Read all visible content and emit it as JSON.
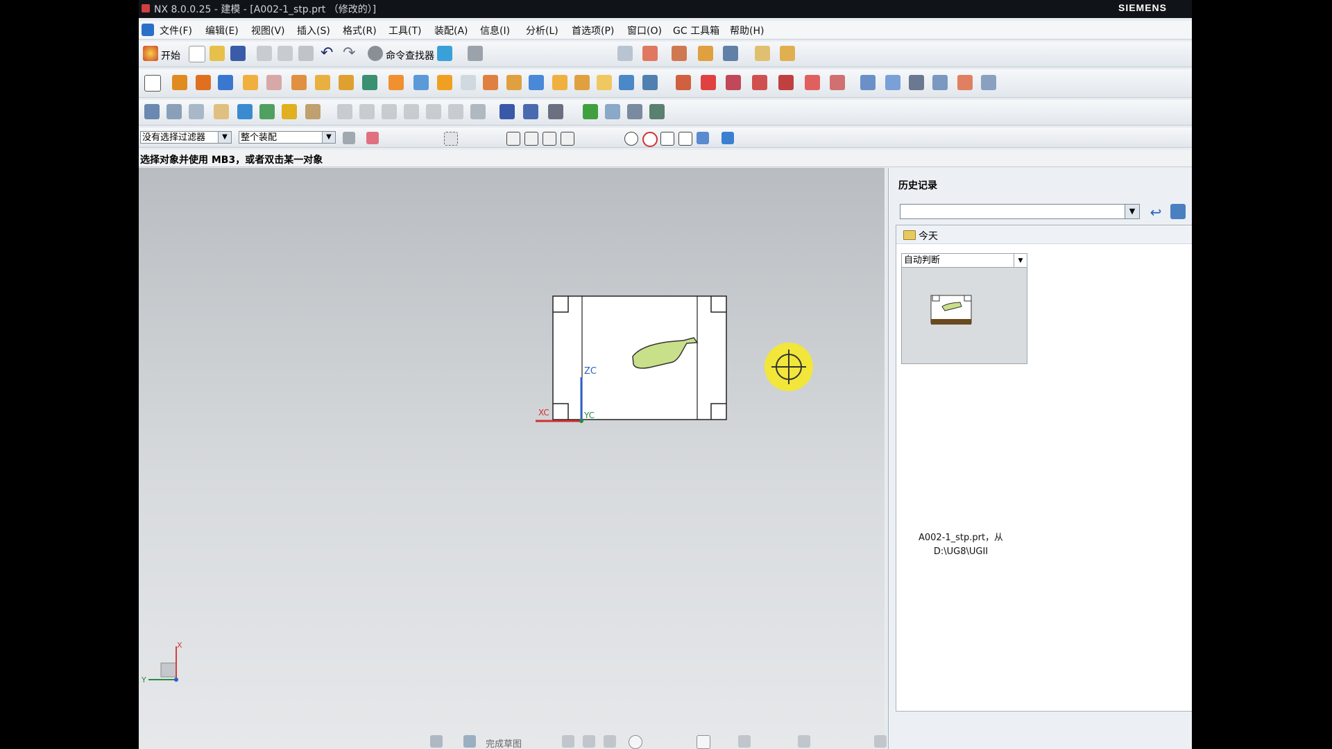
{
  "window": {
    "title": "NX 8.0.0.25 - 建模 - [A002-1_stp.prt （修改的）]",
    "brand": "SIEMENS"
  },
  "menu": [
    "文件(F)",
    "编辑(E)",
    "视图(V)",
    "插入(S)",
    "格式(R)",
    "工具(T)",
    "装配(A)",
    "信息(I)",
    "分析(L)",
    "首选项(P)",
    "窗口(O)",
    "GC 工具箱",
    "帮助(H)"
  ],
  "toolbar": {
    "start_label": "开始",
    "command_finder_label": "命令查找器"
  },
  "selection": {
    "filter": "没有选择过滤器",
    "scope": "整个装配"
  },
  "status": {
    "prompt": "选择对象并使用 MB3，或者双击某一对象"
  },
  "viewport": {
    "wcs": {
      "x_label": "XC",
      "y_label": "YC",
      "z_label": "ZC"
    },
    "triad": {
      "x_label": "X",
      "y_label": "Y"
    }
  },
  "history_panel": {
    "title": "历史记录",
    "group_label": "今天",
    "dropdown_value": "自动判断",
    "entry_caption": "A002-1_stp.prt，从 D:\\UG8\\UGII"
  },
  "bottom_toolbar": {
    "finish_sketch_label": "完成草图"
  },
  "colors": {
    "part_green": "#c8e08a",
    "cursor_highlight": "#f2e63a",
    "wcs_blue": "#3060c8",
    "wcs_red": "#d03030"
  }
}
